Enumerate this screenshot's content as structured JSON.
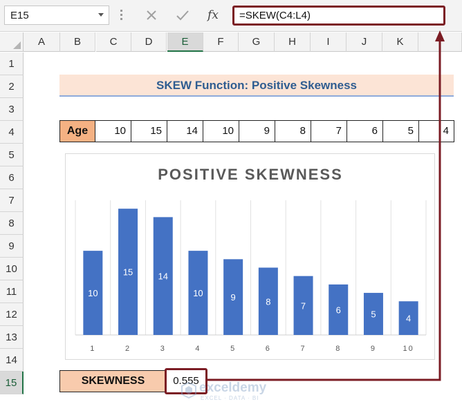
{
  "formula_bar": {
    "name_box": "E15",
    "fx_label": "fx",
    "formula": "=SKEW(C4:L4)"
  },
  "grid": {
    "columns": [
      "A",
      "B",
      "C",
      "D",
      "E",
      "F",
      "G",
      "H",
      "I",
      "J",
      "K"
    ],
    "rows": [
      "1",
      "2",
      "3",
      "4",
      "5",
      "6",
      "7",
      "8",
      "9",
      "10",
      "11",
      "12",
      "13",
      "14",
      "15"
    ],
    "active_column": "E",
    "active_row": "15"
  },
  "sheet": {
    "title": "SKEW Function: Positive Skewness",
    "age_label": "Age",
    "age_values": [
      "10",
      "15",
      "14",
      "10",
      "9",
      "8",
      "7",
      "6",
      "5",
      "4"
    ],
    "result_label": "SKEWNESS",
    "result_value": "0.555"
  },
  "chart_data": {
    "type": "bar",
    "title": "POSITIVE SKEWNESS",
    "categories": [
      "1",
      "2",
      "3",
      "4",
      "5",
      "6",
      "7",
      "8",
      "9",
      "10"
    ],
    "values": [
      10,
      15,
      14,
      10,
      9,
      8,
      7,
      6,
      5,
      4
    ],
    "ylim": [
      0,
      16
    ],
    "grid": "vertical gridlines",
    "data_labels": true,
    "bar_color": "#4472c4",
    "xlabel": "",
    "ylabel": ""
  },
  "watermark": {
    "name": "exceldemy",
    "tagline": "EXCEL · DATA · BI"
  },
  "colors": {
    "highlight_border": "#7b1c24",
    "title_fill": "#fce4d6",
    "label_fill": "#f4b183",
    "result_fill": "#f8cbad",
    "title_text": "#2f5d91",
    "excel_green": "#217346"
  },
  "icons": {
    "cancel": "close-icon",
    "enter": "checkmark-icon",
    "function": "fx-icon",
    "dropdown": "chevron-down-icon"
  }
}
